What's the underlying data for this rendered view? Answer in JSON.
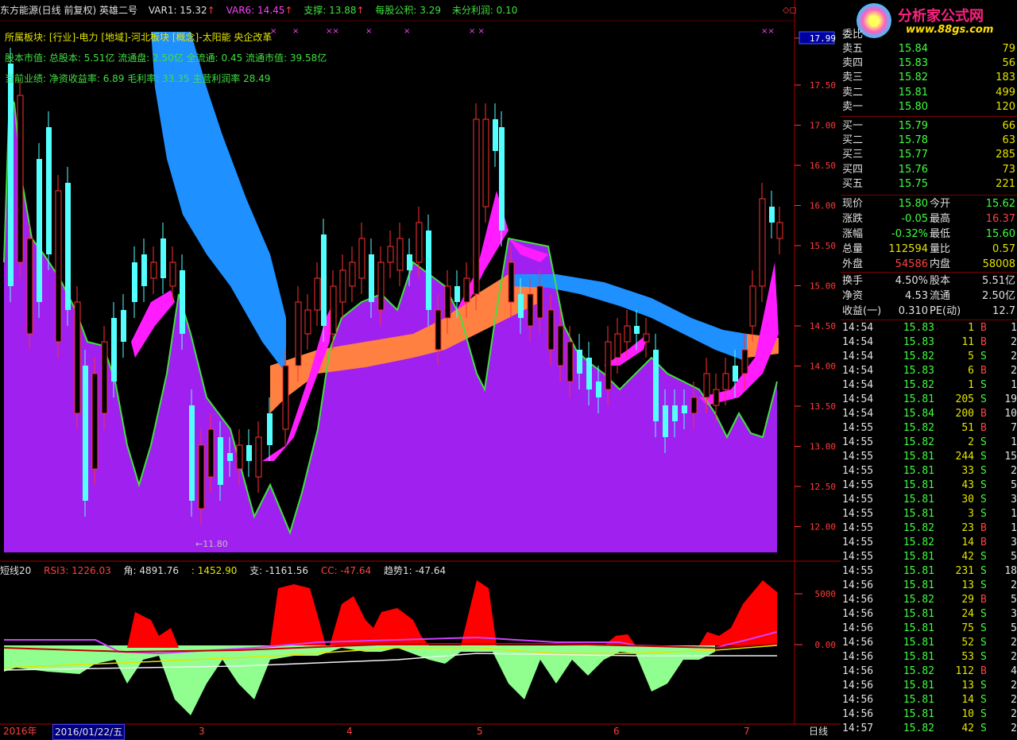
{
  "topbar": {
    "title": "东方能源(日线 前复权) 英雄二号",
    "var1": "VAR1: 15.32",
    "var6": "VAR6: 14.45",
    "support": "支撑: 13.88",
    "fund": "每股公积: 3.29",
    "profit": "未分利润: 0.10"
  },
  "info": {
    "line1": "所属板块: [行业]-电力 [地域]-河北板块 [概念]-太阳能 央企改革",
    "line2": "股本市值: 总股本: 5.51亿 流通盘: 2.50亿 全流通: 0.45 流通市值: 39.58亿",
    "line3": "当前业绩: 净资收益率: 6.89 毛利率: 33.35 主营利润率 28.49"
  },
  "low_label": "←11.80",
  "price_axis": [
    "17.99",
    "17.50",
    "17.00",
    "16.50",
    "16.00",
    "15.50",
    "15.00",
    "14.50",
    "14.00",
    "13.50",
    "13.00",
    "12.50",
    "12.00"
  ],
  "sub_axis": [
    "5000",
    "0.00"
  ],
  "subbar": {
    "short": "短线20",
    "rsi": "RSI3: 1226.03",
    "angle": "角: 4891.76",
    "val3": ": 1452.90",
    "support": "支: -1161.56",
    "cc": "CC: -47.64",
    "trend": "趋势1: -47.64"
  },
  "dates": {
    "year": "2016年",
    "cursor": "2016/01/22/五",
    "months": [
      "3",
      "4",
      "5",
      "6",
      "7"
    ],
    "period": "日线"
  },
  "logo": {
    "title": "分析家公式网",
    "url": "www.88gs.com"
  },
  "weibi": "委比",
  "asks": [
    {
      "label": "卖五",
      "price": "15.84",
      "vol": "79"
    },
    {
      "label": "卖四",
      "price": "15.83",
      "vol": "56"
    },
    {
      "label": "卖三",
      "price": "15.82",
      "vol": "183"
    },
    {
      "label": "卖二",
      "price": "15.81",
      "vol": "499"
    },
    {
      "label": "卖一",
      "price": "15.80",
      "vol": "120"
    }
  ],
  "bids": [
    {
      "label": "买一",
      "price": "15.79",
      "vol": "66"
    },
    {
      "label": "买二",
      "price": "15.78",
      "vol": "63"
    },
    {
      "label": "买三",
      "price": "15.77",
      "vol": "285"
    },
    {
      "label": "买四",
      "price": "15.76",
      "vol": "73"
    },
    {
      "label": "买五",
      "price": "15.75",
      "vol": "221"
    }
  ],
  "stats1": [
    {
      "l1": "现价",
      "v1": "15.80",
      "c1": "dn",
      "l2": "今开",
      "v2": "15.62",
      "c2": "dn"
    },
    {
      "l1": "涨跌",
      "v1": "-0.05",
      "c1": "dn",
      "l2": "最高",
      "v2": "16.37",
      "c2": "up"
    },
    {
      "l1": "涨幅",
      "v1": "-0.32%",
      "c1": "dn",
      "l2": "最低",
      "v2": "15.60",
      "c2": "dn"
    },
    {
      "l1": "总量",
      "v1": "112594",
      "c1": "yl",
      "l2": "量比",
      "v2": "0.57",
      "c2": "yl"
    },
    {
      "l1": "外盘",
      "v1": "54586",
      "c1": "up",
      "l2": "内盘",
      "v2": "58008",
      "c2": "yl"
    }
  ],
  "stats2": [
    {
      "l1": "换手",
      "v1": "4.50%",
      "c1": "wh",
      "l2": "股本",
      "v2": "5.51亿",
      "c2": "wh"
    },
    {
      "l1": "净资",
      "v1": "4.53",
      "c1": "wh",
      "l2": "流通",
      "v2": "2.50亿",
      "c2": "wh"
    },
    {
      "l1": "收益(一)",
      "v1": "0.310",
      "c1": "wh",
      "l2": "PE(动)",
      "v2": "12.7",
      "c2": "wh"
    }
  ],
  "ticks": [
    {
      "t": "14:54",
      "p": "15.83",
      "v": "1",
      "d": "B",
      "n": "1"
    },
    {
      "t": "14:54",
      "p": "15.83",
      "v": "11",
      "d": "B",
      "n": "2"
    },
    {
      "t": "14:54",
      "p": "15.82",
      "v": "5",
      "d": "S",
      "n": "2"
    },
    {
      "t": "14:54",
      "p": "15.83",
      "v": "6",
      "d": "B",
      "n": "2"
    },
    {
      "t": "14:54",
      "p": "15.82",
      "v": "1",
      "d": "S",
      "n": "1"
    },
    {
      "t": "14:54",
      "p": "15.81",
      "v": "205",
      "d": "S",
      "n": "19"
    },
    {
      "t": "14:54",
      "p": "15.84",
      "v": "200",
      "d": "B",
      "n": "10"
    },
    {
      "t": "14:55",
      "p": "15.82",
      "v": "51",
      "d": "B",
      "n": "7"
    },
    {
      "t": "14:55",
      "p": "15.82",
      "v": "2",
      "d": "S",
      "n": "1"
    },
    {
      "t": "14:55",
      "p": "15.81",
      "v": "244",
      "d": "S",
      "n": "15"
    },
    {
      "t": "14:55",
      "p": "15.81",
      "v": "33",
      "d": "S",
      "n": "2"
    },
    {
      "t": "14:55",
      "p": "15.81",
      "v": "43",
      "d": "S",
      "n": "5"
    },
    {
      "t": "14:55",
      "p": "15.81",
      "v": "30",
      "d": "S",
      "n": "3"
    },
    {
      "t": "14:55",
      "p": "15.81",
      "v": "3",
      "d": "S",
      "n": "1"
    },
    {
      "t": "14:55",
      "p": "15.82",
      "v": "23",
      "d": "B",
      "n": "1"
    },
    {
      "t": "14:55",
      "p": "15.82",
      "v": "14",
      "d": "B",
      "n": "3"
    },
    {
      "t": "14:55",
      "p": "15.81",
      "v": "42",
      "d": "S",
      "n": "5"
    },
    {
      "t": "14:55",
      "p": "15.81",
      "v": "231",
      "d": "S",
      "n": "18"
    },
    {
      "t": "14:56",
      "p": "15.81",
      "v": "13",
      "d": "S",
      "n": "2"
    },
    {
      "t": "14:56",
      "p": "15.82",
      "v": "29",
      "d": "B",
      "n": "5"
    },
    {
      "t": "14:56",
      "p": "15.81",
      "v": "24",
      "d": "S",
      "n": "3"
    },
    {
      "t": "14:56",
      "p": "15.81",
      "v": "75",
      "d": "S",
      "n": "5"
    },
    {
      "t": "14:56",
      "p": "15.81",
      "v": "52",
      "d": "S",
      "n": "2"
    },
    {
      "t": "14:56",
      "p": "15.81",
      "v": "53",
      "d": "S",
      "n": "2"
    },
    {
      "t": "14:56",
      "p": "15.82",
      "v": "112",
      "d": "B",
      "n": "4"
    },
    {
      "t": "14:56",
      "p": "15.81",
      "v": "13",
      "d": "S",
      "n": "2"
    },
    {
      "t": "14:56",
      "p": "15.81",
      "v": "14",
      "d": "S",
      "n": "2"
    },
    {
      "t": "14:56",
      "p": "15.81",
      "v": "10",
      "d": "S",
      "n": "2"
    },
    {
      "t": "14:57",
      "p": "15.82",
      "v": "42",
      "d": "S",
      "n": "2"
    }
  ],
  "colors": {
    "up": "#ff4040",
    "down": "#40ff40",
    "purple": "#a020f0",
    "blue": "#1e90ff",
    "magenta": "#ff1cff",
    "orange": "#ff8040",
    "green_area": "#90ff90",
    "red_area": "#ff0000"
  }
}
